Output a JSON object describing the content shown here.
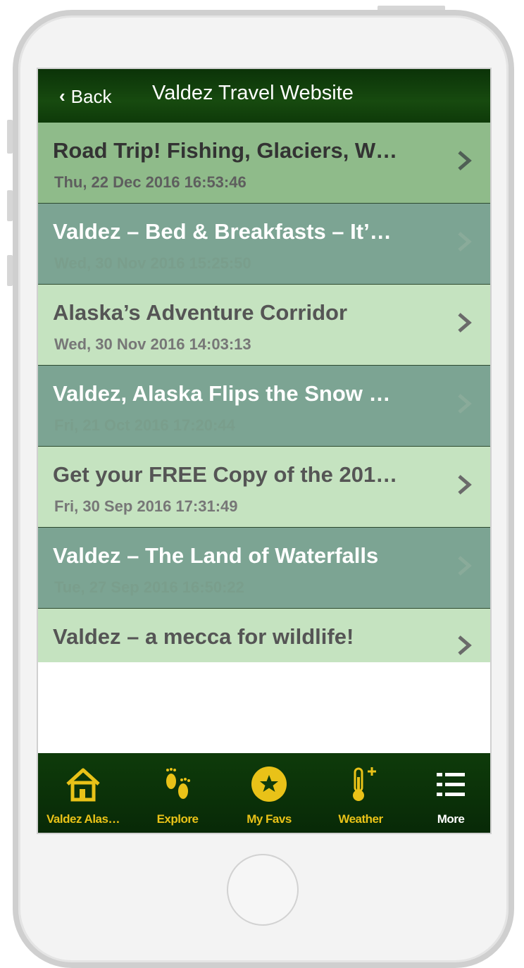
{
  "header": {
    "back_label": "Back",
    "title": "Valdez Travel Website"
  },
  "posts": [
    {
      "title": "Road Trip! Fishing, Glaciers, W…",
      "date": "Thu, 22 Dec 2016 16:53:46"
    },
    {
      "title": "Valdez – Bed & Breakfasts – It’…",
      "date": "Wed, 30 Nov 2016 15:25:50"
    },
    {
      "title": "Alaska’s Adventure Corridor",
      "date": "Wed, 30 Nov 2016 14:03:13"
    },
    {
      "title": "Valdez, Alaska Flips the Snow …",
      "date": "Fri, 21 Oct 2016 17:20:44"
    },
    {
      "title": "Get your FREE Copy of the 201…",
      "date": "Fri, 30 Sep 2016 17:31:49"
    },
    {
      "title": "Valdez – The Land of Waterfalls",
      "date": "Tue, 27 Sep 2016 16:50:22"
    },
    {
      "title": "Valdez – a mecca for wildlife!",
      "date": ""
    }
  ],
  "tabs": [
    {
      "label": "Valdez Alas…",
      "icon": "house-icon"
    },
    {
      "label": "Explore",
      "icon": "footprints-icon"
    },
    {
      "label": "My Favs",
      "icon": "star-icon"
    },
    {
      "label": "Weather",
      "icon": "thermometer-icon"
    },
    {
      "label": "More",
      "icon": "list-icon"
    }
  ],
  "colors": {
    "header_bg": "#174a0f",
    "row_first": "#8fbb8a",
    "row_light": "#c5e3c0",
    "row_dark": "#7ca493",
    "tab_label": "#e9c218",
    "tab_label_active": "#ffffff"
  }
}
